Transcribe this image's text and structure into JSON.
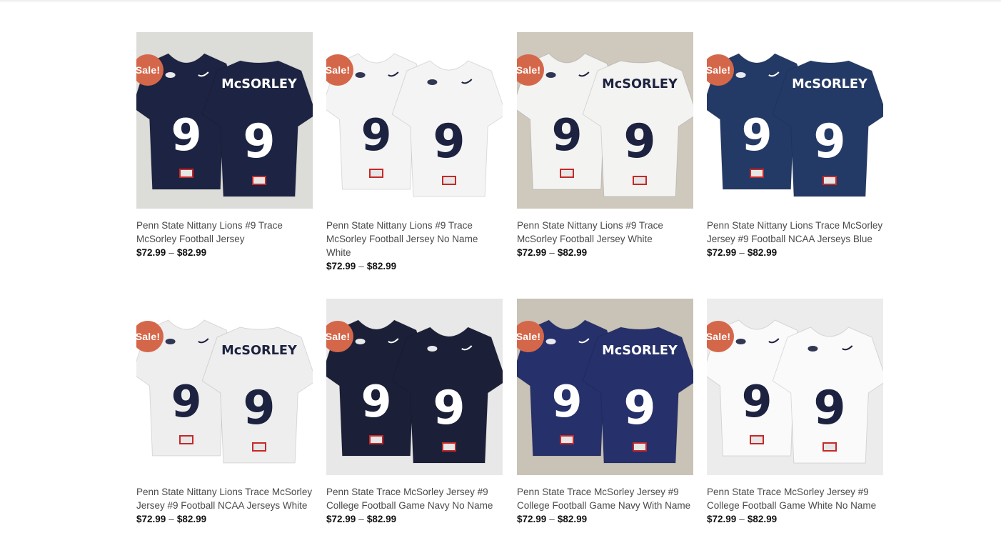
{
  "products": [
    {
      "badge": "Sale!",
      "title": "Penn State Nittany Lions #9 Trace McSorley Football Jersey",
      "price_min": "$72.99",
      "price_sep": "–",
      "price_max": "$82.99",
      "image": {
        "bg": "#dcdcd8",
        "jersey_a": "#1d2342",
        "jersey_b": "#1d2342",
        "num_color": "#ffffff",
        "name_text": "McSORLEY",
        "num": "9"
      }
    },
    {
      "badge": "Sale!",
      "title": "Penn State Nittany Lions #9 Trace McSorley Football Jersey No Name White",
      "price_min": "$72.99",
      "price_sep": "–",
      "price_max": "$82.99",
      "image": {
        "bg": "#ffffff",
        "jersey_a": "#f4f4f4",
        "jersey_b": "#f4f4f4",
        "num_color": "#1c2240",
        "name_text": "",
        "num": "9"
      }
    },
    {
      "badge": "Sale!",
      "title": "Penn State Nittany Lions #9 Trace McSorley Football Jersey White",
      "price_min": "$72.99",
      "price_sep": "–",
      "price_max": "$82.99",
      "image": {
        "bg": "#cfc8bd",
        "jersey_a": "#f3f3f1",
        "jersey_b": "#f3f3f1",
        "num_color": "#1c2240",
        "name_text": "McSORLEY",
        "num": "9"
      }
    },
    {
      "badge": "Sale!",
      "title": "Penn State Nittany Lions Trace McSorley Jersey #9 Football NCAA Jerseys Blue",
      "price_min": "$72.99",
      "price_sep": "–",
      "price_max": "$82.99",
      "image": {
        "bg": "#ffffff",
        "jersey_a": "#243a66",
        "jersey_b": "#243a66",
        "num_color": "#ffffff",
        "name_text": "McSORLEY",
        "num": "9"
      }
    },
    {
      "badge": "Sale!",
      "title": "Penn State Nittany Lions Trace McSorley Jersey #9 Football NCAA Jerseys White",
      "price_min": "$72.99",
      "price_sep": "–",
      "price_max": "$82.99",
      "image": {
        "bg": "#ffffff",
        "jersey_a": "#eeeeee",
        "jersey_b": "#eeeeee",
        "num_color": "#1c2240",
        "name_text": "McSORLEY",
        "num": "9"
      }
    },
    {
      "badge": "Sale!",
      "title": "Penn State Trace McSorley Jersey #9 College Football Game Navy No Name",
      "price_min": "$72.99",
      "price_sep": "–",
      "price_max": "$82.99",
      "image": {
        "bg": "#e8e8e8",
        "jersey_a": "#1b2038",
        "jersey_b": "#1b2038",
        "num_color": "#ffffff",
        "name_text": "",
        "num": "9"
      }
    },
    {
      "badge": "Sale!",
      "title": "Penn State Trace McSorley Jersey #9 College Football Game Navy With Name",
      "price_min": "$72.99",
      "price_sep": "–",
      "price_max": "$82.99",
      "image": {
        "bg": "#c9c2b6",
        "jersey_a": "#26306a",
        "jersey_b": "#26306a",
        "num_color": "#ffffff",
        "name_text": "McSORLEY",
        "num": "9"
      }
    },
    {
      "badge": "Sale!",
      "title": "Penn State Trace McSorley Jersey #9 College Football Game White No Name",
      "price_min": "$72.99",
      "price_sep": "–",
      "price_max": "$82.99",
      "image": {
        "bg": "#ececec",
        "jersey_a": "#fafafa",
        "jersey_b": "#fafafa",
        "num_color": "#1c2240",
        "name_text": "",
        "num": "9"
      }
    }
  ]
}
